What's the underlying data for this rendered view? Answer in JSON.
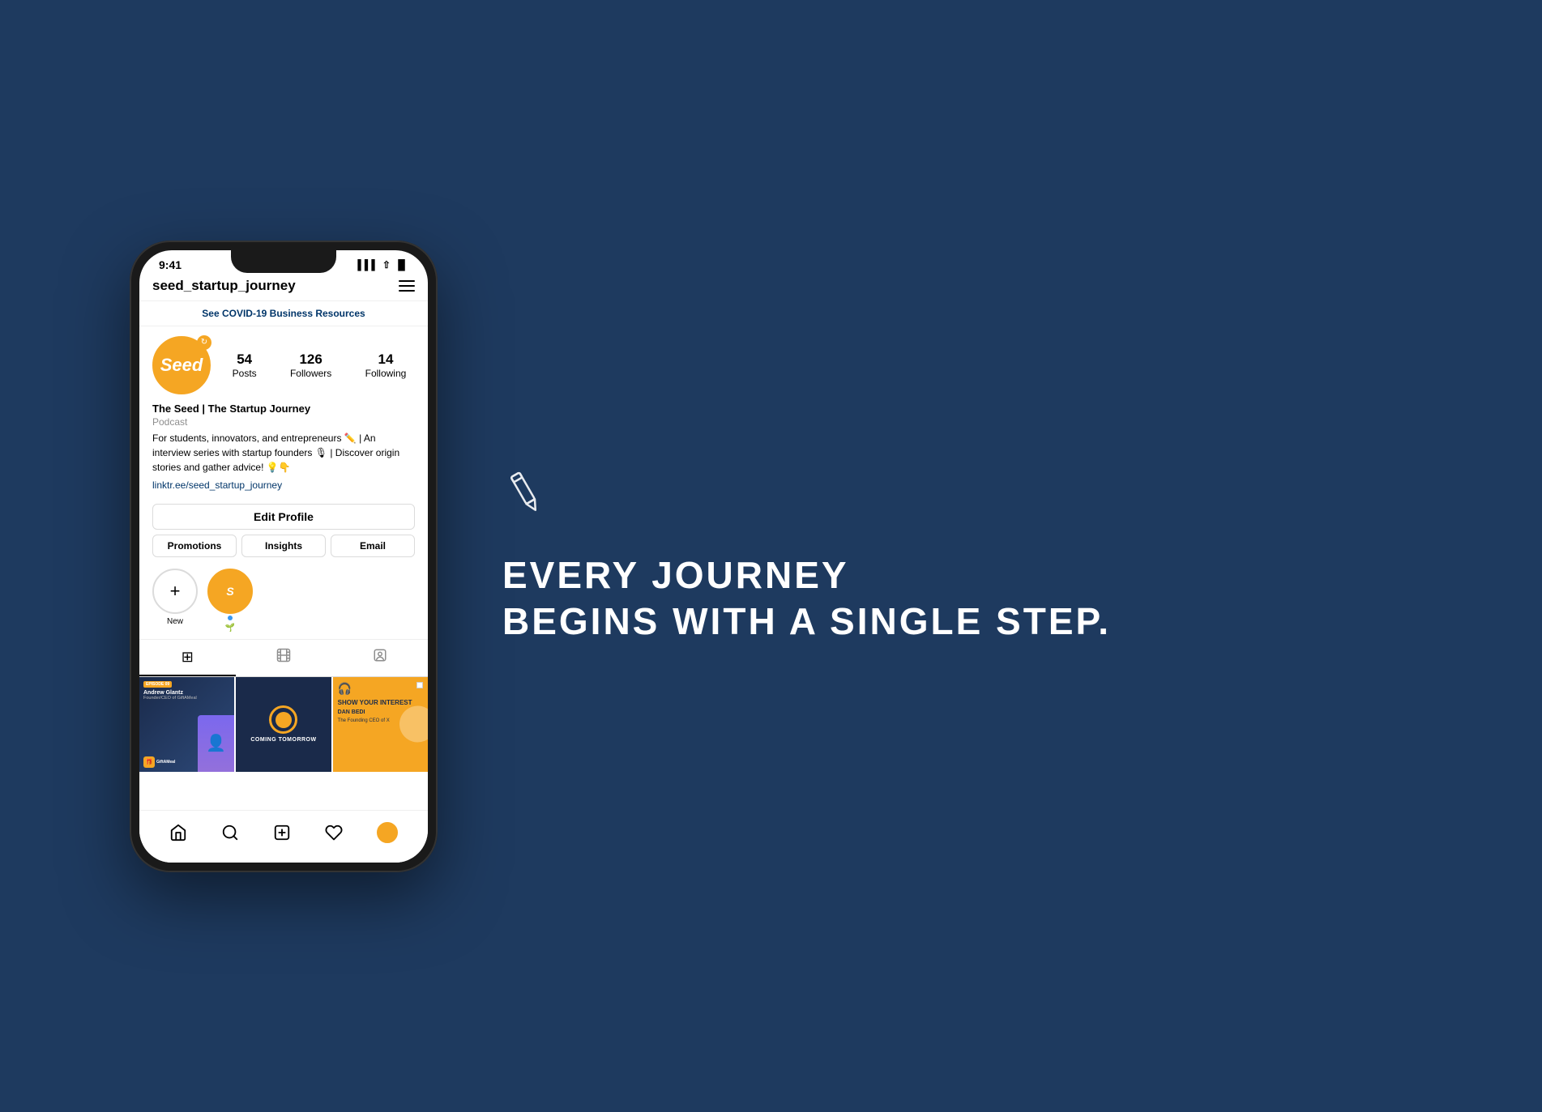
{
  "page": {
    "background_color": "#1e3a5f"
  },
  "phone": {
    "status_bar": {
      "time": "9:41",
      "signal": "▌▌▌",
      "wifi": "WiFi",
      "battery": "Battery"
    },
    "header": {
      "username": "seed_startup_journey",
      "menu_icon": "hamburger"
    },
    "covid_banner": {
      "text": "See COVID-19 Business Resources"
    },
    "profile": {
      "avatar_text": "Seed",
      "stats": [
        {
          "number": "54",
          "label": "Posts"
        },
        {
          "number": "126",
          "label": "Followers"
        },
        {
          "number": "14",
          "label": "Following"
        }
      ],
      "name": "The Seed | The Startup Journey",
      "category": "Podcast",
      "bio": "For students, innovators, and entrepreneurs ✏️ | An interview series with startup founders 🎙 | Discover origin stories and gather advice! 💡👇",
      "link": "linktr.ee/seed_startup_journey"
    },
    "buttons": {
      "edit_profile": "Edit Profile",
      "promotions": "Promotions",
      "insights": "Insights",
      "email": "Email"
    },
    "stories": [
      {
        "label": "New",
        "type": "add"
      },
      {
        "label": "",
        "type": "story"
      }
    ],
    "tabs": [
      {
        "icon": "⊞",
        "type": "grid",
        "active": true
      },
      {
        "icon": "⊡",
        "type": "reels",
        "active": false
      },
      {
        "icon": "👤",
        "type": "tagged",
        "active": false
      }
    ],
    "posts": [
      {
        "type": "andrew",
        "episode": "EPISODE 09",
        "name": "Andrew Glantz",
        "title": "Founder/CEO of GiftAMeal",
        "brand": "GiftAMeal"
      },
      {
        "type": "coming",
        "text": "COMING TOMORROW"
      },
      {
        "type": "interest",
        "heading": "SHOW YOUR INTEREST",
        "name": "DAN BEDI",
        "title": "The Founding CEO of X"
      }
    ],
    "bottom_nav": [
      {
        "icon": "home",
        "glyph": "⌂",
        "active": false
      },
      {
        "icon": "search",
        "glyph": "⚲",
        "active": false
      },
      {
        "icon": "add",
        "glyph": "⊕",
        "active": false
      },
      {
        "icon": "heart",
        "glyph": "♡",
        "active": false
      },
      {
        "icon": "profile",
        "glyph": "avatar",
        "active": true
      }
    ]
  },
  "tagline": {
    "line1": "EVERY JOURNEY",
    "line2": "BEGINS WITH A SINGLE STEP."
  },
  "pencil_icon": "pencil"
}
